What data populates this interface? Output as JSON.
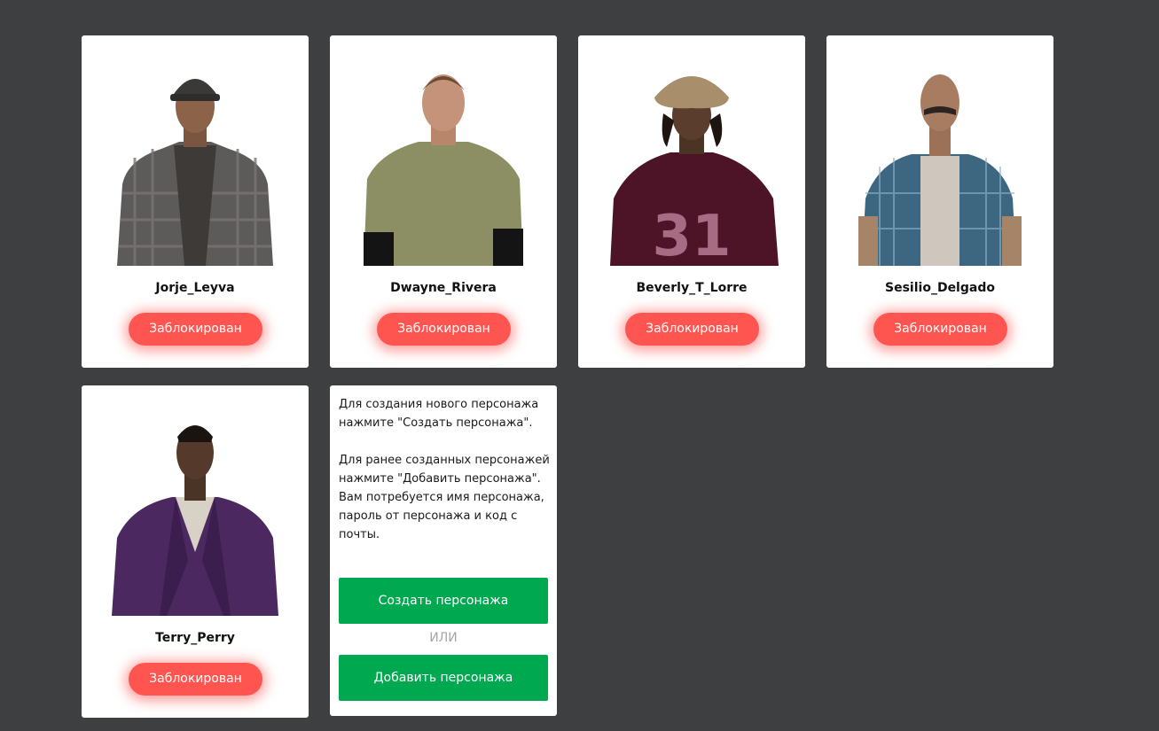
{
  "characters": [
    {
      "name": "Jorje_Leyva",
      "status": "Заблокирован",
      "portrait_icon": "character-portrait-icon"
    },
    {
      "name": "Dwayne_Rivera",
      "status": "Заблокирован",
      "portrait_icon": "character-portrait-icon"
    },
    {
      "name": "Beverly_T_Lorre",
      "status": "Заблокирован",
      "portrait_icon": "character-portrait-icon"
    },
    {
      "name": "Sesilio_Delgado",
      "status": "Заблокирован",
      "portrait_icon": "character-portrait-icon"
    },
    {
      "name": "Terry_Perry",
      "status": "Заблокирован",
      "portrait_icon": "character-portrait-icon"
    }
  ],
  "info": {
    "text": "Для создания нового персонажа нажмите \"Создать персонажа\".\n\nДля ранее созданных персонажей нажмите \"Добавить персонажа\". Вам потребуется имя персонажа, пароль от персонажа и код с почты.",
    "create_label": "Создать персонажа",
    "or_label": "ИЛИ",
    "add_label": "Добавить персонажа"
  },
  "colors": {
    "background": "#3e3f41",
    "blocked_button": "#ff5551",
    "action_button": "#00a94f"
  }
}
